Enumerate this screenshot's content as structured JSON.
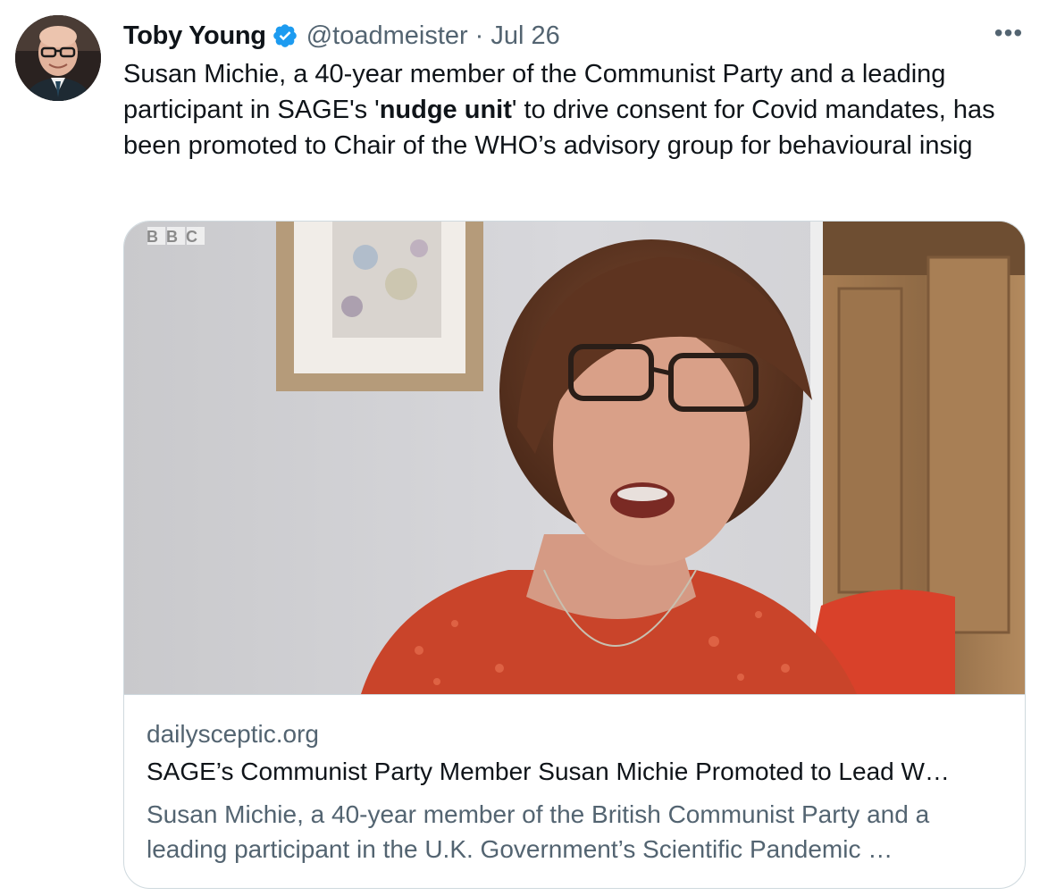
{
  "author": {
    "name": "Toby Young",
    "handle": "@toadmeister",
    "separator": "·",
    "date": "Jul 26",
    "verified": true
  },
  "menu": {
    "more_label": "•••"
  },
  "tweet": {
    "text_before": "Susan Michie, a 40-year member of the Communist Party and a leading participant in SAGE's '",
    "text_bold": "nudge unit",
    "text_after": "' to drive consent for Covid mandates, has been promoted to Chair of the WHO’s advisory group for behavioural insig"
  },
  "card": {
    "image_watermark": "BBC",
    "domain": "dailysceptic.org",
    "title": "SAGE’s Communist Party Member Susan Michie Promoted to Lead W…",
    "description_line1": "Susan Michie, a 40-year member of the British Communist Party and a",
    "description_line2": "leading participant in the U.K. Government’s Scientific Pandemic …"
  },
  "colors": {
    "verified_badge": "#1d9bf0",
    "secondary_text": "#536471",
    "primary_text": "#0f1419",
    "card_border": "#cfd9de"
  },
  "icons": {
    "verified": "verified-badge-icon",
    "more": "more-options-icon"
  }
}
